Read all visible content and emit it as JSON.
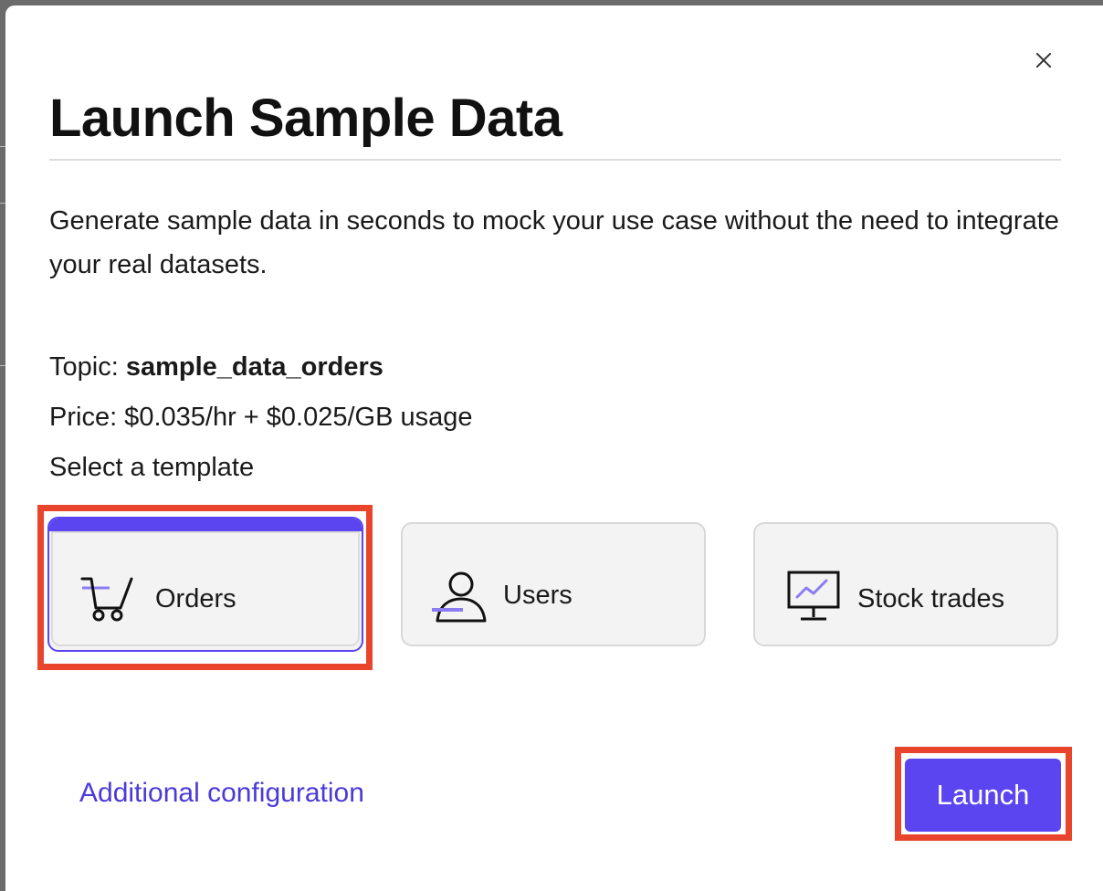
{
  "dialog": {
    "title": "Launch Sample Data",
    "description": "Generate sample data in seconds to mock your use case without the need to integrate your real datasets.",
    "topic_label": "Topic:",
    "topic_value": "sample_data_orders",
    "price": "Price: $0.035/hr + $0.025/GB usage",
    "select_template_label": "Select a template"
  },
  "templates": [
    {
      "label": "Orders",
      "icon": "cart-icon",
      "selected": true
    },
    {
      "label": "Users",
      "icon": "user-icon",
      "selected": false
    },
    {
      "label": "Stock trades",
      "icon": "monitor-chart-icon",
      "selected": false
    }
  ],
  "footer": {
    "additional_configuration": "Additional configuration",
    "launch_label": "Launch"
  },
  "colors": {
    "accent": "#5b45f0",
    "link": "#4a3ad9",
    "highlight": "#e8452c"
  }
}
